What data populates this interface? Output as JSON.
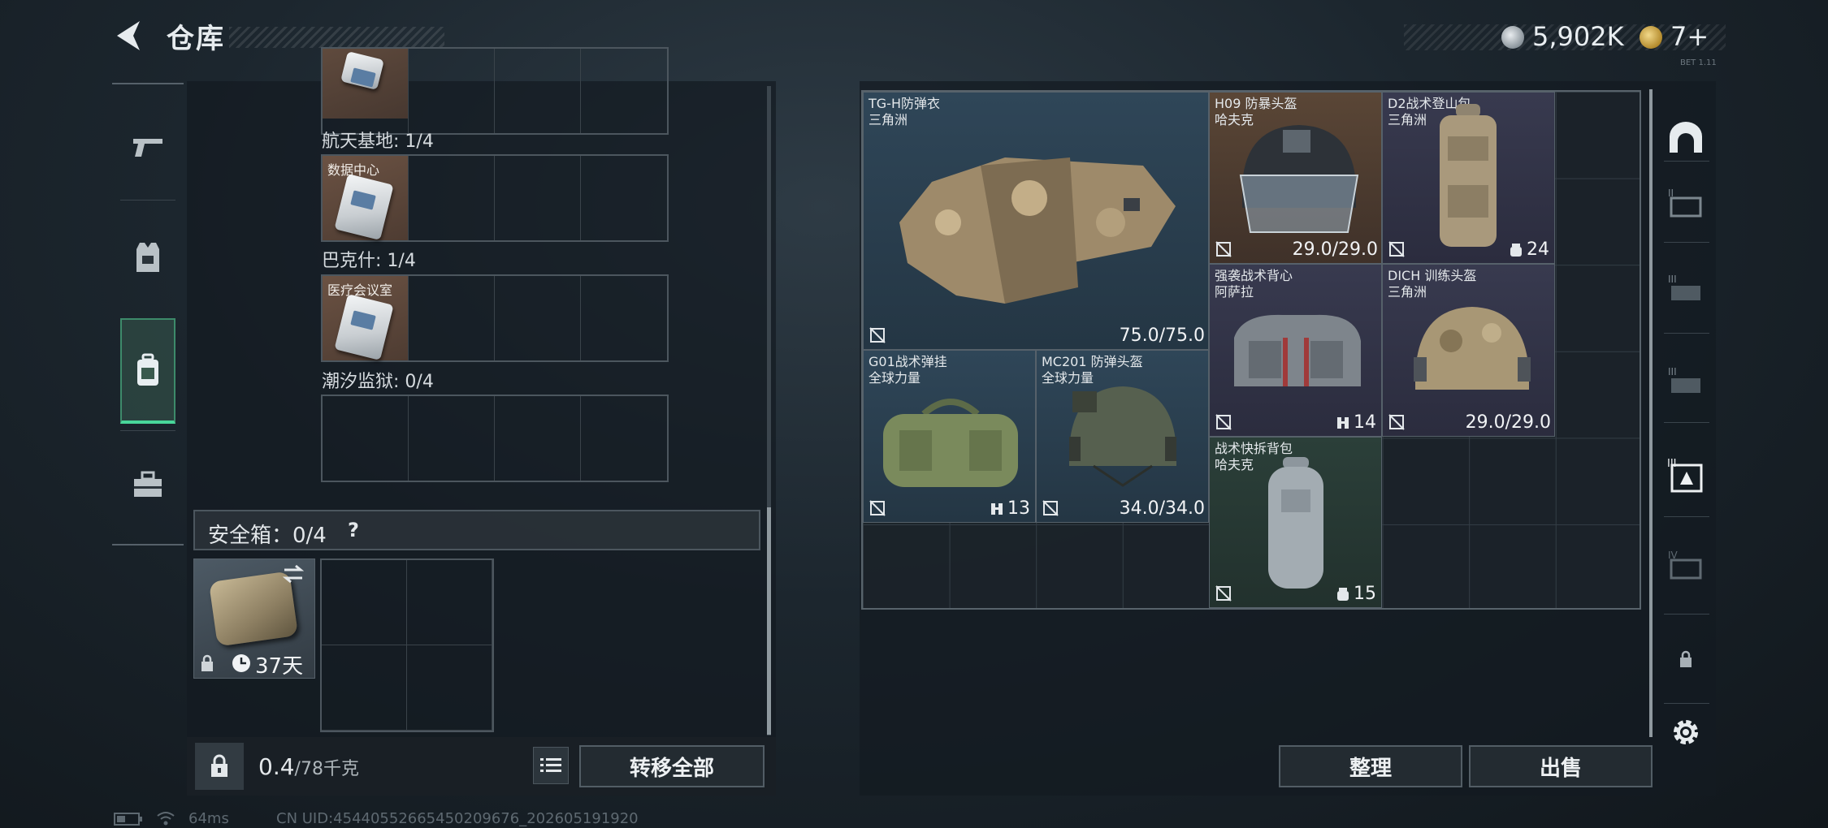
{
  "header": {
    "title": "仓库",
    "silver_currency": "5,902K",
    "gold_currency": "7+",
    "corner_small": "BET 1.11"
  },
  "left_nav": {
    "items": [
      {
        "icon": "pistol-icon"
      },
      {
        "icon": "vest-icon"
      },
      {
        "icon": "backpack-icon",
        "active": true
      },
      {
        "icon": "briefcase-icon"
      }
    ]
  },
  "left_panel": {
    "sections": [
      {
        "label": "航天基地: 1/4"
      },
      {
        "label": "巴克什: 1/4",
        "item_label": "数据中心"
      },
      {
        "label": "潮汐监狱: 0/4",
        "item_label": "医疗会议室"
      }
    ],
    "safe_box": {
      "label": "安全箱：0/4",
      "help": "?",
      "days": "37天"
    },
    "weight": "0.4",
    "weight_max": "/78千克",
    "transfer_all": "转移全部"
  },
  "stash": {
    "items": [
      {
        "name": "TG-H防弹衣",
        "sub": "三角洲",
        "value": "75.0/75.0"
      },
      {
        "name": "H09 防暴头盔",
        "sub": "哈夫克",
        "value": "29.0/29.0"
      },
      {
        "name": "D2战术登山包",
        "sub": "三角洲",
        "count": "24"
      },
      {
        "name": "强袭战术背心",
        "sub": "阿萨拉",
        "count": "14"
      },
      {
        "name": "DICH 训练头盔",
        "sub": "三角洲",
        "value": "29.0/29.0"
      },
      {
        "name": "G01战术弹挂",
        "sub": "全球力量",
        "count": "13"
      },
      {
        "name": "MC201 防弹头盔",
        "sub": "全球力量",
        "value": "34.0/34.0"
      },
      {
        "name": "战术快拆背包",
        "sub": "哈夫克",
        "count": "15"
      }
    ],
    "sort_button": "整理",
    "sell_button": "出售"
  },
  "right_nav": {
    "tabs": [
      "bunker-icon",
      "II",
      "III",
      "III",
      "III",
      "IV",
      "lock-icon"
    ]
  },
  "status_bar": {
    "ping": "64ms",
    "uid": "CN UID:45440552665450209676_202605191920"
  },
  "colors": {
    "accent_green": "#48d69a",
    "rarity_blue": "#2f4658",
    "rarity_brown": "#5a4636",
    "rarity_purple": "#383a4f",
    "rarity_green": "#2b3f39"
  }
}
